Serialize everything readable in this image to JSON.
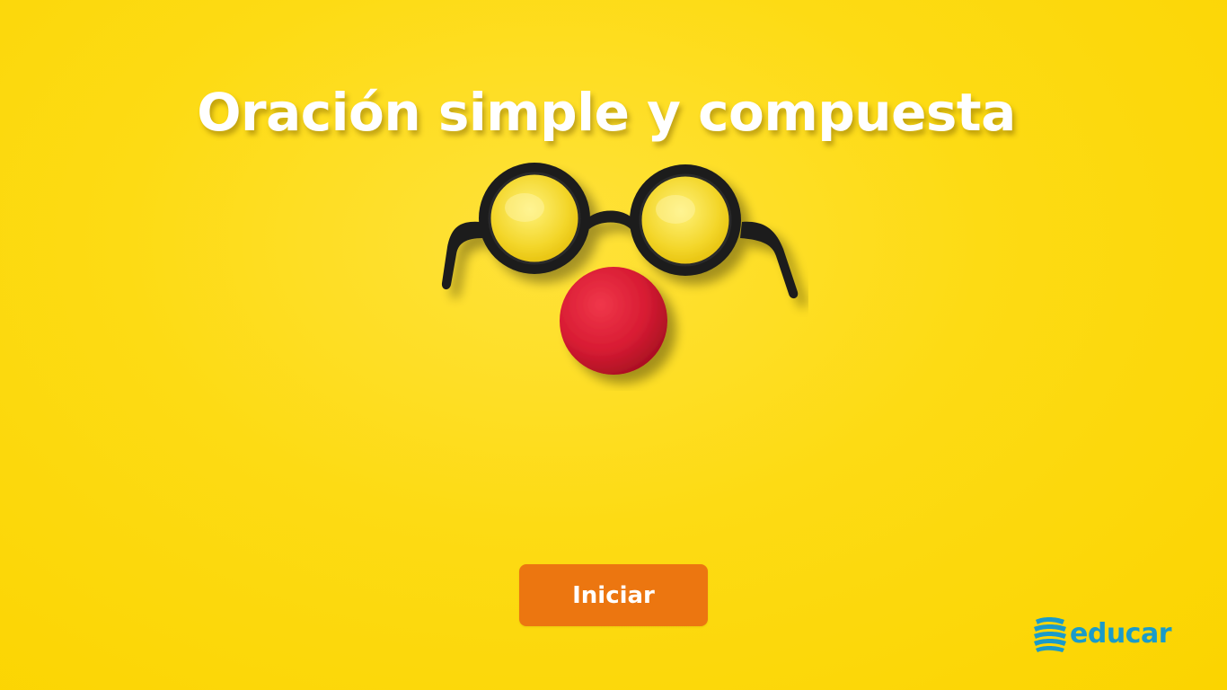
{
  "slide": {
    "title": "Oración simple y compuesta",
    "background_color": "#fddb14",
    "illustration": {
      "icon": "clown-glasses-and-nose-icon",
      "glasses_color": "#1b1b1b",
      "nose_color": "#d81c33"
    }
  },
  "actions": {
    "start_label": "Iniciar",
    "start_color": "#ec7610"
  },
  "brand": {
    "logo_text": "educar",
    "logo_color": "#1a9bc9",
    "logo_icon": "educar-logo-icon"
  }
}
